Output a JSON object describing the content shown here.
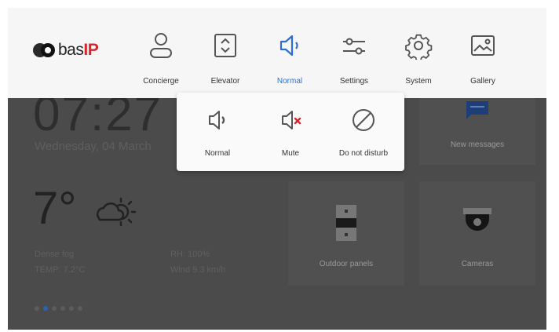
{
  "brand": {
    "logo_text_a": "bas",
    "logo_text_b": "IP"
  },
  "nav": {
    "items": [
      {
        "id": "concierge",
        "label": "Concierge",
        "icon": "person-icon"
      },
      {
        "id": "elevator",
        "label": "Elevator",
        "icon": "elevator-icon"
      },
      {
        "id": "normal",
        "label": "Normal",
        "icon": "speaker-icon",
        "active": true
      },
      {
        "id": "settings",
        "label": "Settings",
        "icon": "sliders-icon"
      },
      {
        "id": "system",
        "label": "System",
        "icon": "gear-icon"
      },
      {
        "id": "gallery",
        "label": "Gallery",
        "icon": "image-icon"
      }
    ],
    "active_color": "#2d6fd1"
  },
  "sound_menu": {
    "options": [
      {
        "id": "normal",
        "label": "Normal",
        "icon": "speaker-icon"
      },
      {
        "id": "mute",
        "label": "Mute",
        "icon": "speaker-mute-icon"
      },
      {
        "id": "dnd",
        "label": "Do not disturb",
        "icon": "do-not-disturb-icon"
      }
    ]
  },
  "dashboard": {
    "time": "07:27",
    "date": "Wednesday, 04 March",
    "temperature": "7°",
    "condition": "Dense fog",
    "temp_detail": "TEMP: 7.2°C",
    "humidity": "RH: 100%",
    "wind": "Wind 9.3 km/h",
    "page_dots": 6,
    "active_dot": 2
  },
  "tiles": {
    "messages_label": "New messages",
    "outdoor_label": "Outdoor panels",
    "cameras_label": "Cameras"
  }
}
